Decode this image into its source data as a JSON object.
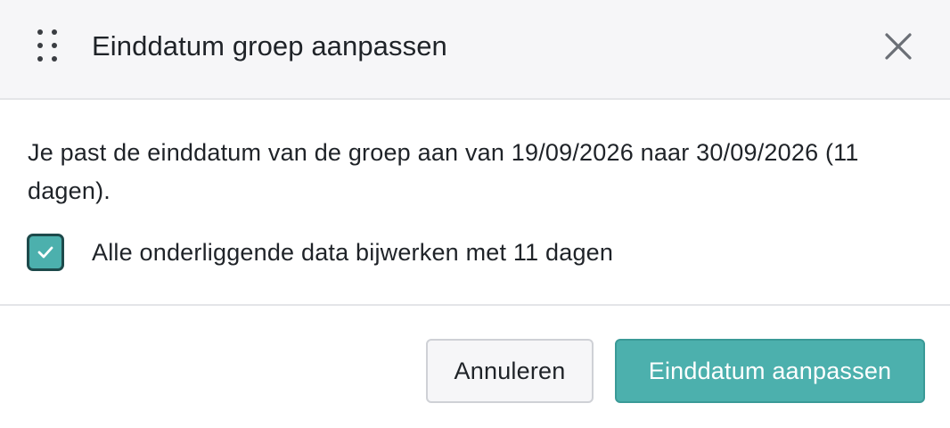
{
  "dialog": {
    "title": "Einddatum groep aanpassen",
    "icons": {
      "drag": "drag-handle-icon",
      "close": "close-icon",
      "check": "check-icon"
    },
    "message": "Je past de einddatum van de groep aan van 19/09/2026 naar 30/09/2026 (11 dagen).",
    "checkbox": {
      "label": "Alle onderliggende data bijwerken met 11 dagen",
      "checked": true
    },
    "buttons": {
      "cancel_label": "Annuleren",
      "confirm_label": "Einddatum aanpassen"
    }
  },
  "colors": {
    "accent": "#4cb0ad",
    "checkbox_border": "#1d4a4b",
    "header_background": "#f6f6f8",
    "text": "#1f2328"
  }
}
